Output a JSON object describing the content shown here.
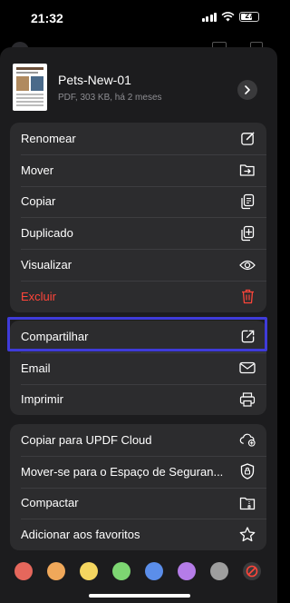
{
  "status": {
    "time": "21:32",
    "battery": "27"
  },
  "file": {
    "name": "Pets-New-01",
    "meta": "PDF, 303 KB, há 2 meses"
  },
  "group1": [
    {
      "label": "Renomear",
      "icon": "edit-icon"
    },
    {
      "label": "Mover",
      "icon": "move-folder-icon"
    },
    {
      "label": "Copiar",
      "icon": "copy-icon"
    },
    {
      "label": "Duplicado",
      "icon": "duplicate-icon"
    },
    {
      "label": "Visualizar",
      "icon": "eye-icon"
    },
    {
      "label": "Excluir",
      "icon": "trash-icon",
      "color": "#ff453a"
    }
  ],
  "group2": [
    {
      "label": "Compartilhar",
      "icon": "share-icon"
    },
    {
      "label": "Email",
      "icon": "mail-icon"
    },
    {
      "label": "Imprimir",
      "icon": "printer-icon"
    }
  ],
  "group3": [
    {
      "label": "Copiar para UPDF Cloud",
      "icon": "cloud-upload-icon"
    },
    {
      "label": "Mover-se para o Espaço de Seguran...",
      "icon": "shield-lock-icon"
    },
    {
      "label": "Compactar",
      "icon": "zip-folder-icon"
    },
    {
      "label": "Adicionar aos favoritos",
      "icon": "star-icon"
    }
  ],
  "tag_colors": [
    "#e5675c",
    "#f0a85a",
    "#f5d660",
    "#7dd672",
    "#5b8eea",
    "#b57ce8",
    "#9e9e9e"
  ],
  "highlight_color": "#3f3bd9"
}
